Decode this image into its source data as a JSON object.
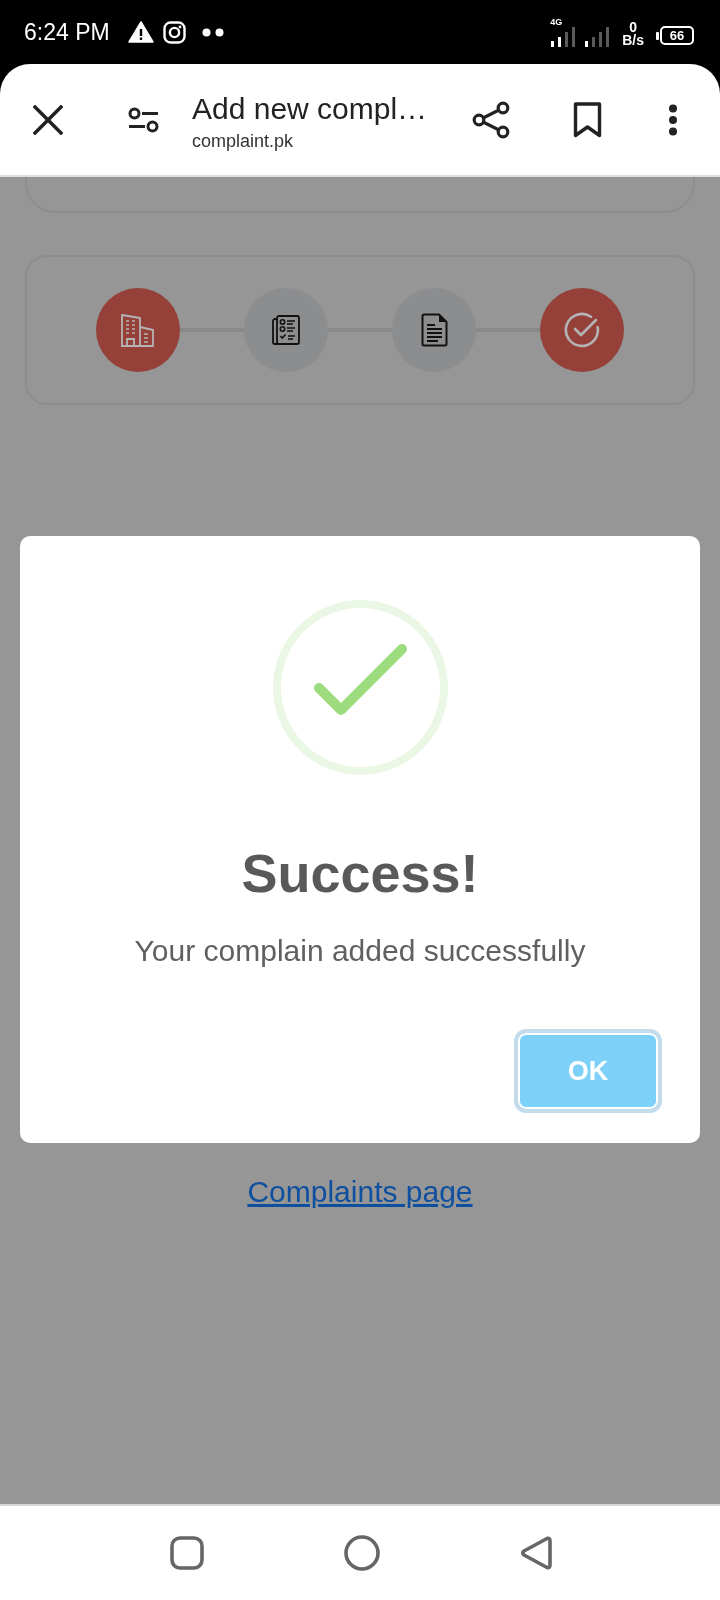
{
  "status_bar": {
    "time": "6:24 PM",
    "network": "4G",
    "data_rate": "0",
    "data_unit": "B/s",
    "battery": "66"
  },
  "browser_bar": {
    "title": "Add new compl…",
    "url": "complaint.pk"
  },
  "stepper": {
    "steps": [
      {
        "done": true
      },
      {
        "done": false
      },
      {
        "done": false
      },
      {
        "done": true
      }
    ]
  },
  "dialog": {
    "title": "Success!",
    "message": "Your complain added successfully",
    "buttons": [
      "OK"
    ]
  },
  "page": {
    "link": "Complaints page"
  }
}
